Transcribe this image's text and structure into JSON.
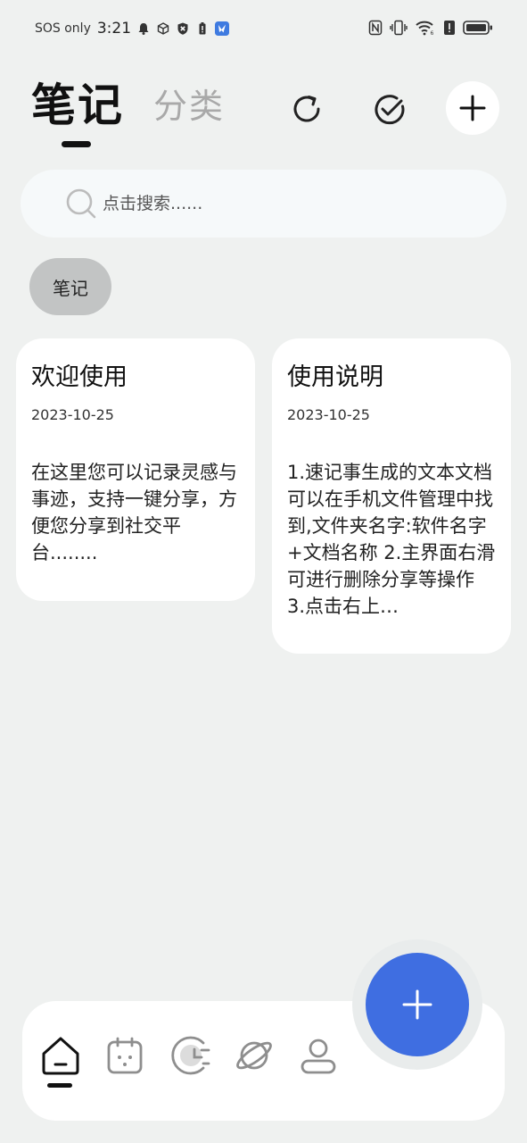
{
  "status_bar": {
    "network": "SOS only",
    "time": "3:21"
  },
  "header": {
    "active_tab": "笔记",
    "inactive_tab": "分类",
    "icons": [
      "refresh-icon",
      "check-circle-icon",
      "plus-icon"
    ]
  },
  "search": {
    "placeholder": "点击搜索......"
  },
  "chip": {
    "label": "笔记"
  },
  "notes": [
    {
      "title": "欢迎使用",
      "date": "2023-10-25",
      "preview": "在这里您可以记录灵感与事迹，支持一键分享，方便您分享到社交平台........"
    },
    {
      "title": "使用说明",
      "date": "2023-10-25",
      "preview": "1.速记事生成的文本文档可以在手机文件管理中找到,文件夹名字:软件名字+文档名称 2.主界面右滑可进行删除分享等操作 3.点击右上…"
    }
  ],
  "bottom_nav": {
    "items": [
      "home-icon",
      "calendar-icon",
      "clock-icon",
      "planet-icon",
      "user-icon"
    ],
    "active": "home-icon"
  },
  "colors": {
    "background": "#eff1f0",
    "fab": "#3f6ee1",
    "chip": "#c2c4c4",
    "inactive_tab": "#a9a9a9"
  }
}
